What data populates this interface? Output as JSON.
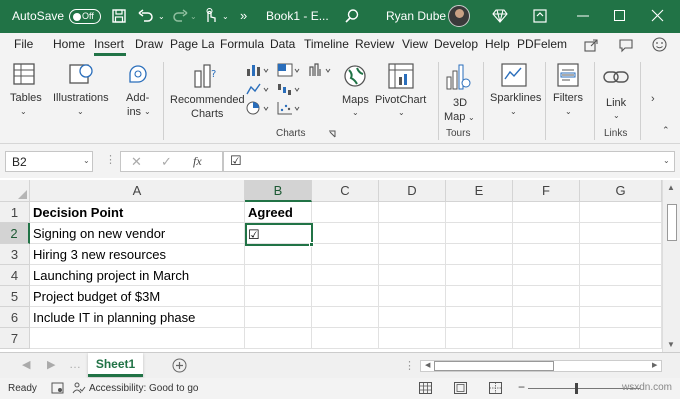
{
  "titlebar": {
    "autosave_label": "AutoSave",
    "autosave_state": "Off",
    "more": "»",
    "doc_title": "Book1 - E...",
    "user_name": "Ryan Dube"
  },
  "tabs": [
    "File",
    "Home",
    "Insert",
    "Draw",
    "Page Lay",
    "Formula",
    "Data",
    "Timeline",
    "Review",
    "View",
    "Develop",
    "Help",
    "PDFelem"
  ],
  "active_tab": "Insert",
  "ribbon": {
    "tables": "Tables",
    "illustrations": "Illustrations",
    "addins_1": "Add-",
    "addins_2": "ins",
    "recommended_1": "Recommended",
    "recommended_2": "Charts",
    "maps": "Maps",
    "pivotchart": "PivotChart",
    "map3d_1": "3D",
    "map3d_2": "Map",
    "sparklines": "Sparklines",
    "filters": "Filters",
    "link": "Link",
    "group_charts": "Charts",
    "group_tours": "Tours",
    "group_links": "Links"
  },
  "formula_bar": {
    "name_box": "B2",
    "fx": "fx",
    "content": "☑"
  },
  "columns": [
    "A",
    "B",
    "C",
    "D",
    "E",
    "F",
    "G"
  ],
  "rows": [
    "1",
    "2",
    "3",
    "4",
    "5",
    "6",
    "7"
  ],
  "cells": {
    "A1": "Decision Point",
    "B1": "Agreed",
    "A2": "Signing on new vendor",
    "B2": "☑",
    "A3": "Hiring 3 new resources",
    "A4": "Launching project in March",
    "A5": "Project budget of $3M",
    "A6": "Include IT in planning phase"
  },
  "sheet_tab": "Sheet1",
  "status": {
    "ready": "Ready",
    "accessibility": "Accessibility: Good to go",
    "watermark": "wsxdn.com"
  },
  "colors": {
    "accent": "#217346"
  }
}
